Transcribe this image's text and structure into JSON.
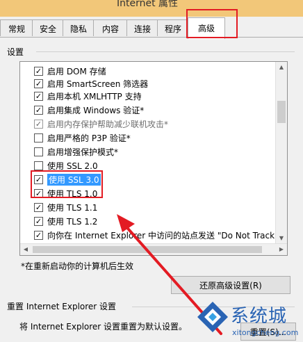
{
  "window": {
    "title": "Internet 属性"
  },
  "tabs": [
    "常规",
    "安全",
    "隐私",
    "内容",
    "连接",
    "程序",
    "高级"
  ],
  "settings": {
    "title": "设置",
    "items": [
      {
        "label": "启用 DOM 存储",
        "checked": true,
        "disabled": false,
        "selected": false
      },
      {
        "label": "启用 SmartScreen 筛选器",
        "checked": true,
        "disabled": false,
        "selected": false
      },
      {
        "label": "启用本机 XMLHTTP 支持",
        "checked": true,
        "disabled": false,
        "selected": false
      },
      {
        "label": "启用集成 Windows 验证*",
        "checked": true,
        "disabled": false,
        "selected": false
      },
      {
        "label": "启用内存保护帮助减少联机攻击*",
        "checked": true,
        "disabled": true,
        "selected": false
      },
      {
        "label": "启用严格的 P3P 验证*",
        "checked": false,
        "disabled": false,
        "selected": false
      },
      {
        "label": "启用增强保护模式*",
        "checked": false,
        "disabled": false,
        "selected": false
      },
      {
        "label": "使用 SSL 2.0",
        "checked": false,
        "disabled": false,
        "selected": false
      },
      {
        "label": "使用 SSL 3.0",
        "checked": true,
        "disabled": false,
        "selected": true
      },
      {
        "label": "使用 TLS 1.0",
        "checked": true,
        "disabled": false,
        "selected": false
      },
      {
        "label": "使用 TLS 1.1",
        "checked": true,
        "disabled": false,
        "selected": false
      },
      {
        "label": "使用 TLS 1.2",
        "checked": true,
        "disabled": false,
        "selected": false
      },
      {
        "label": "向你在 Internet Explorer 中访问的站点发送 \"Do Not Track\"",
        "checked": true,
        "disabled": false,
        "selected": false
      }
    ]
  },
  "note": "*在重新启动你的计算机后生效",
  "restore_button": "还原高级设置(R)",
  "reset": {
    "title": "重置 Internet Explorer 设置",
    "description": "将 Internet Explorer 设置重置为默认设置。",
    "button": "重置(S)..."
  },
  "watermark": {
    "text": "系统城",
    "url": "xitongcheng.com"
  },
  "colors": {
    "highlight": "#e31b23",
    "selection": "#3399ff",
    "brand": "#2a64b4"
  }
}
